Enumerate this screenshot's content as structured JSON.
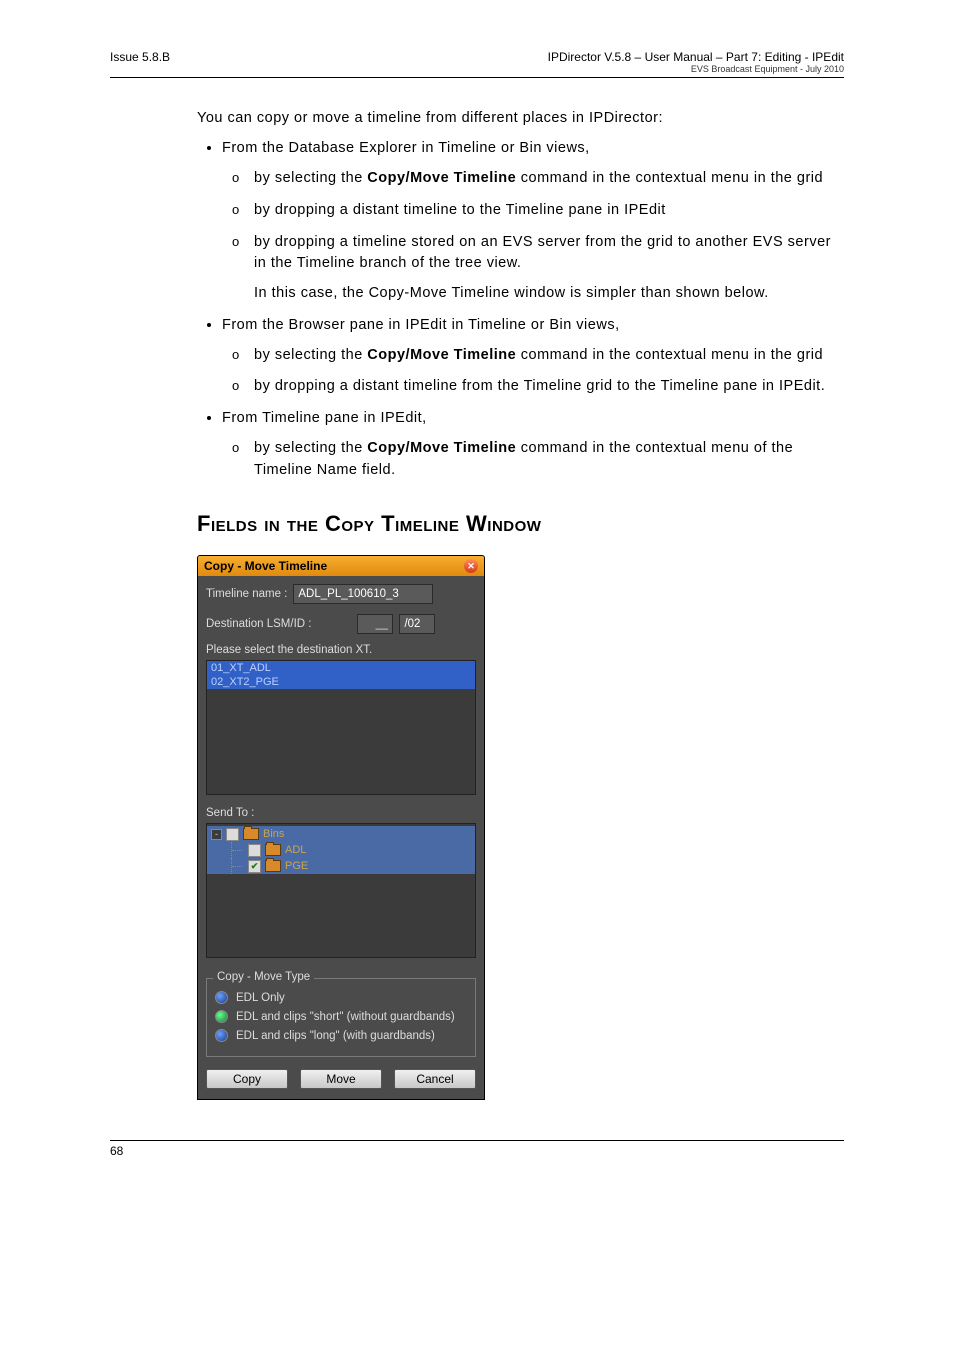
{
  "header": {
    "left": "Issue 5.8.B",
    "right1": "IPDirector V.5.8 – User Manual – Part 7: Editing - IPEdit",
    "right2": "EVS Broadcast Equipment -   July 2010"
  },
  "intro": "You can copy or move a timeline from different places in IPDirector:",
  "b1": {
    "lead": "From the Database Explorer in Timeline or Bin views,",
    "s1a": "by selecting the ",
    "s1b": "Copy/Move Timeline",
    "s1c": " command in the contextual menu in the grid",
    "s2": "by dropping a distant timeline to the Timeline pane in IPEdit",
    "s3": "by dropping a timeline stored on an EVS server from the grid to another EVS server in the Timeline branch of the tree view.",
    "s3note": "In this case, the Copy-Move Timeline window is simpler than shown below."
  },
  "b2": {
    "lead": "From the Browser pane in IPEdit in Timeline or Bin views,",
    "s1a": "by selecting the ",
    "s1b": "Copy/Move Timeline",
    "s1c": " command in the contextual menu in the grid",
    "s2": "by dropping a distant timeline from the Timeline grid to the Timeline pane in IPEdit."
  },
  "b3": {
    "lead": "From Timeline pane in IPEdit,",
    "s1a": "by selecting the ",
    "s1b": "Copy/Move Timeline",
    "s1c": " command in the contextual menu of the Timeline Name field."
  },
  "section_title": "Fields in the Copy Timeline Window",
  "dialog": {
    "title": "Copy - Move Timeline",
    "timeline_label": "Timeline name :",
    "timeline_value": "ADL_PL_100610_3",
    "dest_label": "Destination LSM/ID :",
    "dest_left": "__",
    "dest_right": "/02",
    "please_select": "Please select the destination XT.",
    "xt_list": [
      "01_XT_ADL",
      "02_XT2_PGE"
    ],
    "sendto_label": "Send To :",
    "tree": {
      "root": "Bins",
      "children": [
        {
          "label": "ADL",
          "checked": false
        },
        {
          "label": "PGE",
          "checked": true
        }
      ]
    },
    "copy_move_type_label": "Copy - Move Type",
    "radios": [
      {
        "label": "EDL Only",
        "state": "blue"
      },
      {
        "label": "EDL and clips \"short\" (without guardbands)",
        "state": "green"
      },
      {
        "label": "EDL and clips \"long\" (with guardbands)",
        "state": "blue"
      }
    ],
    "buttons": {
      "copy": "Copy",
      "move": "Move",
      "cancel": "Cancel"
    }
  },
  "footer": {
    "page": "68"
  }
}
